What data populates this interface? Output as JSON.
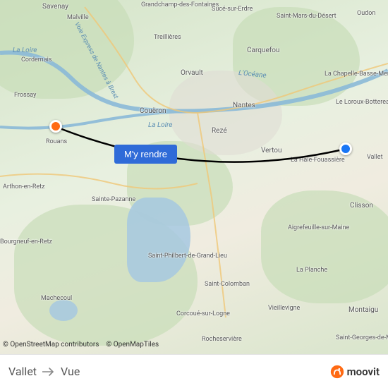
{
  "map": {
    "attribution_osm": "© OpenStreetMap contributors",
    "attribution_tiles": "© OpenMapTiles",
    "rivers": {
      "loire_nw": "La Loire",
      "loire_center": "La Loire",
      "oceane": "L'Océane",
      "nantes_brest": "Voie Express de Nantes à Brest"
    },
    "cities": {
      "savenay": "Savenay",
      "malville": "Malville",
      "grandchamp": "Grandchamp-des-Fontaines",
      "suce": "Sucé-sur-Erdre",
      "saint_mars": "Saint-Mars-du-Désert",
      "oudon": "Oudon",
      "treillieres": "Treillières",
      "carquefou": "Carquefou",
      "orvault": "Orvault",
      "chapelle": "La Chapelle-Basse-Mer",
      "loroux": "Le Loroux-Bottereau",
      "cordemais": "Cordemais",
      "coueron": "Couëron",
      "nantes": "Nantes",
      "frossay": "Frossay",
      "reze": "Rezé",
      "vertou": "Vertou",
      "rouans": "Rouans",
      "haie": "La Haie-Fouassière",
      "vallet": "Vallet",
      "arthon": "Arthon-en-Retz",
      "sainte_pazanne": "Sainte-Pazanne",
      "clisson": "Clisson",
      "aigrefeuille": "Aigrefeuille-sur-Maine",
      "bourgneuf": "Bourgneuf-en-Retz",
      "st_philbert": "Saint-Philbert-de-Grand-Lieu",
      "st_colomban": "Saint-Colomban",
      "la_planche": "La Planche",
      "machecoul": "Machecoul",
      "corcoue": "Corcoué-sur-Logne",
      "vieillevigne": "Vieillevigne",
      "montaigu": "Montaigu",
      "rocheserviere": "Rocheservière",
      "st_georges": "Saint-Georges-de-Montaigu"
    }
  },
  "route": {
    "button_label": "M'y rendre",
    "origin": "Vallet",
    "destination": "Vue"
  },
  "brand": {
    "name": "moovit"
  },
  "colors": {
    "button_bg": "#2f6bd8",
    "marker_start": "#1976f5",
    "marker_end": "#ff6a13",
    "brand_orange": "#ff6a13"
  }
}
